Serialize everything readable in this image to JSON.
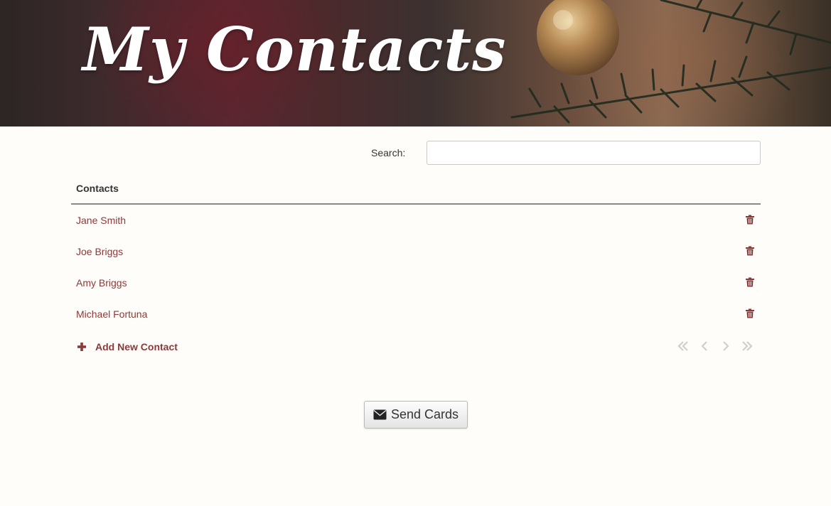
{
  "header": {
    "title": "My Contacts"
  },
  "search": {
    "label": "Search:",
    "value": "",
    "placeholder": ""
  },
  "table": {
    "column_header": "Contacts",
    "rows": [
      {
        "name": "Jane Smith"
      },
      {
        "name": "Joe Briggs"
      },
      {
        "name": "Amy Briggs"
      },
      {
        "name": "Michael Fortuna"
      }
    ]
  },
  "actions": {
    "add_contact_label": "Add New Contact",
    "send_cards_label": "Send Cards"
  },
  "pagination": {
    "icons": [
      "double-chevron-left-icon",
      "chevron-left-icon",
      "chevron-right-icon",
      "double-chevron-right-icon"
    ]
  },
  "colors": {
    "accent": "#8b3a3a",
    "page_background": "#fefdf9",
    "pager_disabled": "#cfcfcf"
  },
  "icons": {
    "row_action": "trash-icon",
    "add": "plus-icon",
    "send": "envelope-icon"
  }
}
